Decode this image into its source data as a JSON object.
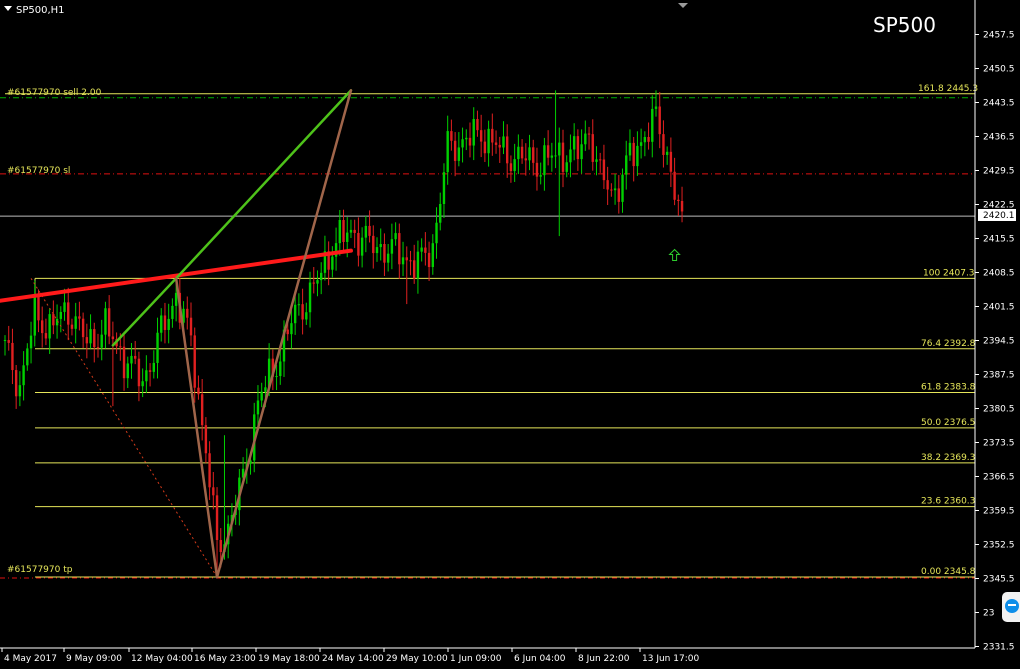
{
  "window": {
    "symbol_timeframe": "SP500,H1",
    "symbol_watermark": "SP500"
  },
  "trade_lines": {
    "sell_label": "#61577970 sell 2.00",
    "sl_label": "#61577970 sl",
    "tp_label": "#61577970 tp"
  },
  "current_price": "2420.1",
  "colors": {
    "background": "#000000",
    "bull_candle": "#00d000",
    "bear_candle": "#e02020",
    "fibo_line": "#e6e65a",
    "trendline_red": "#ff1a1a",
    "trendline_green": "#4ec21a",
    "trendline_brown": "#a0654a",
    "sl_line": "#e01010",
    "sell_line": "#00b000",
    "axis": "#ffffff"
  },
  "icons": {
    "menu": "triangle-down-icon",
    "buy_arrow": "up-arrow-icon",
    "remote": "teamviewer-icon"
  },
  "chart_data": {
    "type": "candlestick",
    "title": "SP500",
    "ylim": [
      2328,
      2462
    ],
    "y_ticks": [
      "2457.5",
      "2450.5",
      "2443.5",
      "2436.5",
      "2429.5",
      "2422.5",
      "2415.5",
      "2408.5",
      "2401.5",
      "2394.5",
      "2387.5",
      "2380.5",
      "2373.5",
      "2366.5",
      "2359.5",
      "2352.5",
      "2345.5",
      "23",
      "2331.5"
    ],
    "x_ticks": [
      "4 May 2017",
      "9 May 09:00",
      "12 May 04:00",
      "16 May 23:00",
      "19 May 18:00",
      "24 May 14:00",
      "29 May 10:00",
      "1 Jun 09:00",
      "6 Jun 04:00",
      "8 Jun 22:00",
      "13 Jun 17:00"
    ],
    "fibonacci_levels": [
      {
        "level": "161.8",
        "price": "2445.3"
      },
      {
        "level": "100",
        "price": "2407.3"
      },
      {
        "level": "76.4",
        "price": "2392.8"
      },
      {
        "level": "61.8",
        "price": "2383.8"
      },
      {
        "level": "50.0",
        "price": "2376.5"
      },
      {
        "level": "38.2",
        "price": "2369.3"
      },
      {
        "level": "23.6",
        "price": "2360.3"
      },
      {
        "level": "0.00",
        "price": "2345.8"
      }
    ],
    "trade_levels": {
      "sell": 2445.3,
      "stop_loss": 2428.8,
      "take_profit": 2345.8
    },
    "current_price": 2420.1,
    "path_key_points": [
      {
        "i": 0,
        "p": 2393
      },
      {
        "i": 4,
        "p": 2385
      },
      {
        "i": 8,
        "p": 2400
      },
      {
        "i": 12,
        "p": 2397
      },
      {
        "i": 17,
        "p": 2401
      },
      {
        "i": 22,
        "p": 2394
      },
      {
        "i": 27,
        "p": 2397
      },
      {
        "i": 32,
        "p": 2391
      },
      {
        "i": 37,
        "p": 2386
      },
      {
        "i": 41,
        "p": 2394
      },
      {
        "i": 46,
        "p": 2404
      },
      {
        "i": 50,
        "p": 2394
      },
      {
        "i": 54,
        "p": 2372
      },
      {
        "i": 57,
        "p": 2352
      },
      {
        "i": 60,
        "p": 2356
      },
      {
        "i": 64,
        "p": 2366
      },
      {
        "i": 68,
        "p": 2382
      },
      {
        "i": 73,
        "p": 2390
      },
      {
        "i": 78,
        "p": 2400
      },
      {
        "i": 83,
        "p": 2405
      },
      {
        "i": 88,
        "p": 2414
      },
      {
        "i": 93,
        "p": 2417
      },
      {
        "i": 99,
        "p": 2414
      },
      {
        "i": 105,
        "p": 2413
      },
      {
        "i": 111,
        "p": 2410
      },
      {
        "i": 115,
        "p": 2414
      },
      {
        "i": 119,
        "p": 2434
      },
      {
        "i": 124,
        "p": 2436
      },
      {
        "i": 129,
        "p": 2437
      },
      {
        "i": 134,
        "p": 2433
      },
      {
        "i": 139,
        "p": 2432
      },
      {
        "i": 144,
        "p": 2431
      },
      {
        "i": 149,
        "p": 2433
      },
      {
        "i": 154,
        "p": 2433
      },
      {
        "i": 157,
        "p": 2438
      },
      {
        "i": 160,
        "p": 2428
      },
      {
        "i": 164,
        "p": 2425
      },
      {
        "i": 168,
        "p": 2432
      },
      {
        "i": 172,
        "p": 2437
      },
      {
        "i": 175,
        "p": 2440
      },
      {
        "i": 178,
        "p": 2433
      },
      {
        "i": 182,
        "p": 2418
      }
    ],
    "wick_extremes": [
      {
        "i": 29,
        "kind": "low",
        "p": 2381
      },
      {
        "i": 57,
        "kind": "low",
        "p": 2346
      },
      {
        "i": 59,
        "kind": "high",
        "p": 2375
      },
      {
        "i": 108,
        "kind": "low",
        "p": 2402
      },
      {
        "i": 148,
        "kind": "high",
        "p": 2446
      },
      {
        "i": 149,
        "kind": "low",
        "p": 2416
      },
      {
        "i": 175,
        "kind": "high",
        "p": 2446
      }
    ],
    "trendlines": [
      {
        "color": "trendline_red",
        "from": {
          "i": -3,
          "p": 2402.5
        },
        "to": {
          "i": 93,
          "p": 2413
        }
      },
      {
        "color": "trendline_green",
        "from": {
          "i": 29,
          "p": 2393.5
        },
        "to": {
          "i": 46,
          "p": 2407.3
        }
      },
      {
        "color": "trendline_green",
        "from": {
          "i": 46,
          "p": 2407.3
        },
        "to": {
          "i": 93,
          "p": 2446
        }
      },
      {
        "color": "trendline_brown",
        "from": {
          "i": 46,
          "p": 2407.3
        },
        "to": {
          "i": 57,
          "p": 2345.8
        }
      },
      {
        "color": "trendline_brown",
        "from": {
          "i": 57,
          "p": 2345.8
        },
        "to": {
          "i": 93,
          "p": 2446
        }
      }
    ],
    "dotted_trendline": {
      "from": {
        "i": 7,
        "p": 2407.3
      },
      "to": {
        "i": 57,
        "p": 2345.8
      }
    },
    "buy_arrow": {
      "i": 180,
      "p": 2412
    }
  }
}
